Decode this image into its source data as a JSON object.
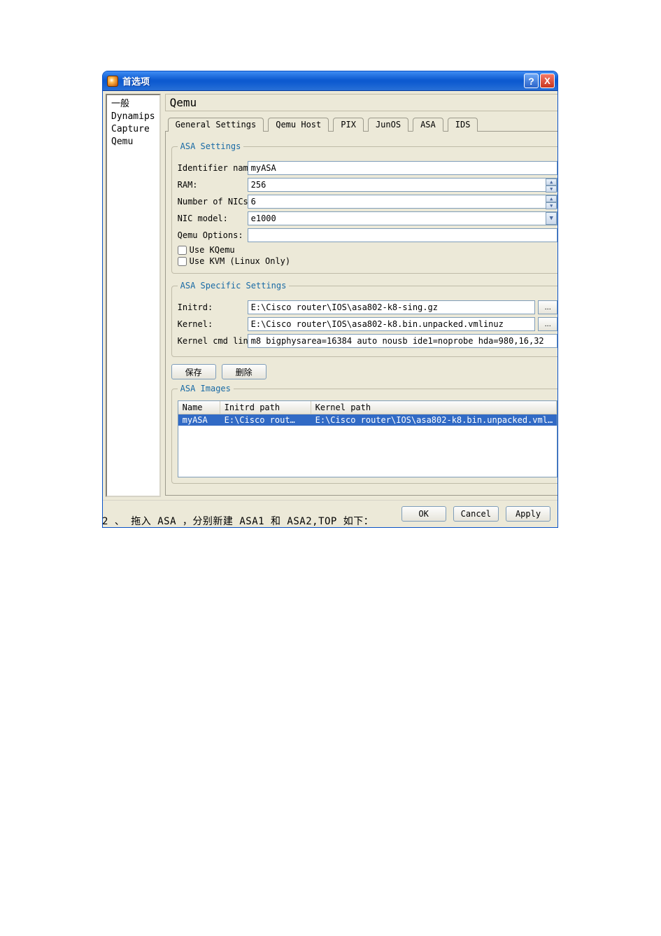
{
  "window": {
    "title": "首选项",
    "help_glyph": "?",
    "close_glyph": "X"
  },
  "sidebar": {
    "items": [
      {
        "label": "一般"
      },
      {
        "label": "Dynamips"
      },
      {
        "label": "Capture"
      },
      {
        "label": "Qemu"
      }
    ]
  },
  "main": {
    "panel_title": "Qemu",
    "tabs": [
      {
        "label": "General Settings",
        "active": false
      },
      {
        "label": "Qemu Host",
        "active": false
      },
      {
        "label": "PIX",
        "active": false
      },
      {
        "label": "JunOS",
        "active": false
      },
      {
        "label": "ASA",
        "active": true
      },
      {
        "label": "IDS",
        "active": false
      }
    ]
  },
  "asa_settings": {
    "legend": "ASA Settings",
    "identifier_label": "Identifier name:",
    "identifier_value": "myASA",
    "ram_label": "RAM:",
    "ram_value": "256",
    "nics_label": "Number of NICs:",
    "nics_value": "6",
    "nic_model_label": "NIC model:",
    "nic_model_value": "e1000",
    "qemu_options_label": "Qemu Options:",
    "qemu_options_value": "",
    "use_kqemu_label": "Use KQemu",
    "use_kvm_label": "Use KVM (Linux Only)"
  },
  "asa_specific": {
    "legend": "ASA Specific Settings",
    "initrd_label": "Initrd:",
    "initrd_value": "E:\\Cisco router\\IOS\\asa802-k8-sing.gz",
    "kernel_label": "Kernel:",
    "kernel_value": "E:\\Cisco router\\IOS\\asa802-k8.bin.unpacked.vmlinuz",
    "cmdline_label": "Kernel cmd line:",
    "cmdline_value": "m8 bigphysarea=16384 auto nousb ide1=noprobe hda=980,16,32",
    "browse_label": "..."
  },
  "buttons": {
    "save": "保存",
    "delete": "删除",
    "ok": "OK",
    "cancel": "Cancel",
    "apply": "Apply"
  },
  "asa_images": {
    "legend": "ASA Images",
    "columns": {
      "name": "Name",
      "initrd": "Initrd path",
      "kernel": "Kernel path"
    },
    "rows": [
      {
        "name": "myASA",
        "initrd": "E:\\Cisco rout…",
        "kernel": "E:\\Cisco router\\IOS\\asa802-k8.bin.unpacked.vml…"
      }
    ]
  },
  "caption_below": "2 、 拖入 ASA ，分别新建 ASA1 和 ASA2,TOP 如下："
}
